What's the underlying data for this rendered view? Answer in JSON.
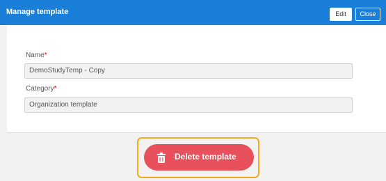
{
  "header": {
    "title": "Manage template",
    "edit_label": "Edit",
    "close_label": "Close"
  },
  "form": {
    "name_label": "Name",
    "name_value": "DemoStudyTemp - Copy",
    "category_label": "Category",
    "category_value": "Organization template",
    "required_marker": "*"
  },
  "footer": {
    "delete_label": "Delete template"
  },
  "colors": {
    "header_bg": "#1a7fd8",
    "delete_bg": "#e8505b",
    "highlight": "#f0a81e",
    "required": "#d0021b"
  },
  "icons": {
    "delete": "trash-icon"
  }
}
